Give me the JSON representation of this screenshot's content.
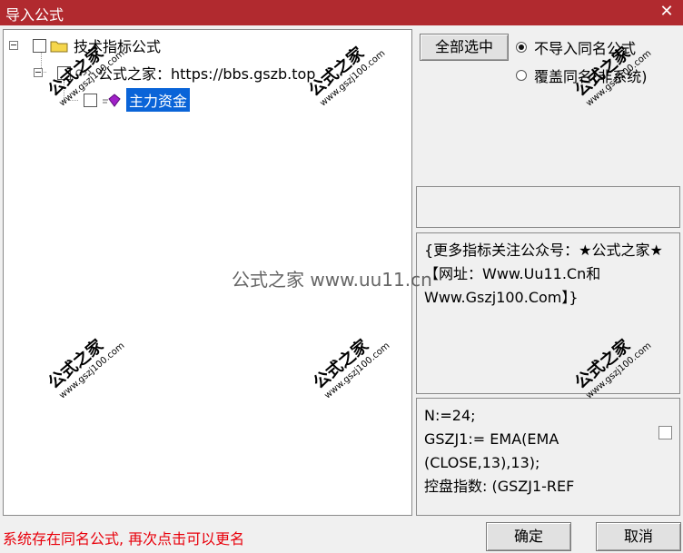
{
  "window": {
    "title": "导入公式",
    "close_glyph": "✕"
  },
  "tree": {
    "root": {
      "label": "技术指标公式"
    },
    "child": {
      "label": "公式之家：https://bbs.gszb.top"
    },
    "leaf": {
      "label": "主力资金"
    }
  },
  "right_panel": {
    "select_all_label": "全部选中",
    "radio_options": [
      {
        "label": "不导入同名公式",
        "selected": true
      },
      {
        "label": "覆盖同名(非系统)",
        "selected": false
      }
    ],
    "description": "{更多指标关注公众号：★公式之家★ 【网址：Www.Uu11.Cn和Www.Gszj100.Com】}",
    "code_lines": [
      "N:=24;",
      "GSZJ1:= EMA(EMA",
      "(CLOSE,13),13);",
      "控盘指数: (GSZJ1-REF"
    ]
  },
  "status_text": "系统存在同名公式, 再次点击可以更名",
  "buttons": {
    "ok": "确定",
    "cancel": "取消"
  },
  "watermarks": {
    "center": "公式之家 www.uu11.cn",
    "stamp_title": "公式之家",
    "stamp_url": "www.gszj100.com"
  },
  "colors": {
    "titlebar": "#b12a2f",
    "selection": "#0a64d8",
    "status": "#e8000b"
  }
}
